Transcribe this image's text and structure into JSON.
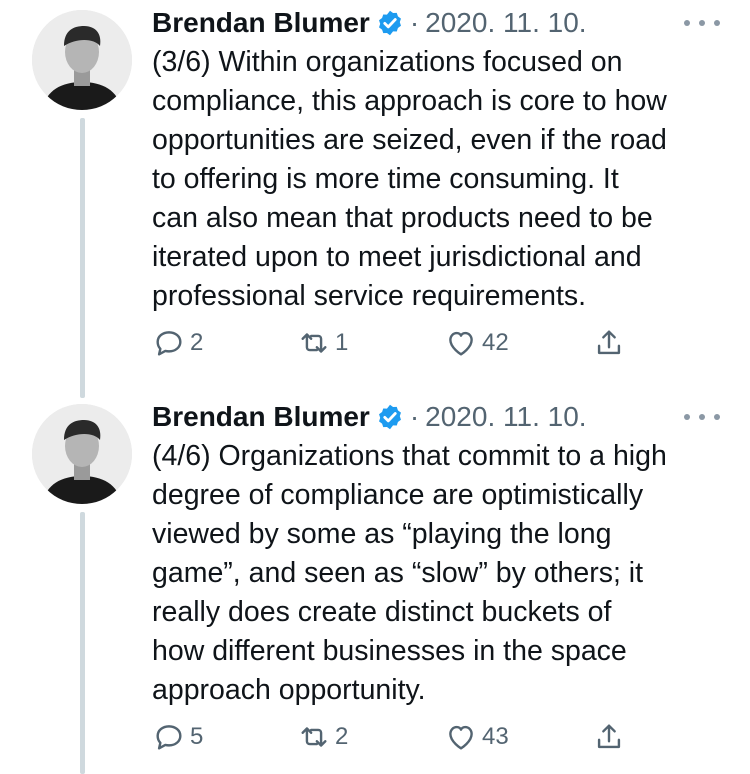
{
  "tweets": [
    {
      "author": "Brendan Blumer",
      "separator": "·",
      "date": "2020. 11. 10.",
      "lines": [
        "(3/6) Within organizations focused on",
        "compliance, this approach is core to how",
        "opportunities are seized, even if the road",
        "to offering is more time consuming. It",
        "can also mean that products need to be",
        "iterated upon to meet jurisdictional and",
        "professional service requirements."
      ],
      "replies": "2",
      "retweets": "1",
      "likes": "42"
    },
    {
      "author": "Brendan Blumer",
      "separator": "·",
      "date": "2020. 11. 10.",
      "lines": [
        "(4/6) Organizations that commit to a high",
        "degree of compliance are optimistically",
        "viewed by some as “playing the long",
        "game”, and seen as “slow” by others; it",
        "really does create distinct buckets of",
        "how different businesses in the space",
        "approach opportunity."
      ],
      "replies": "5",
      "retweets": "2",
      "likes": "43"
    }
  ],
  "icons": {
    "verified": "verified-badge-icon",
    "more": "more-options-icon",
    "reply": "reply-icon",
    "retweet": "retweet-icon",
    "like": "heart-icon",
    "share": "share-icon"
  },
  "colors": {
    "verified": "#1d9bf0",
    "muted": "#536471",
    "thread_line": "#cfd9de"
  }
}
